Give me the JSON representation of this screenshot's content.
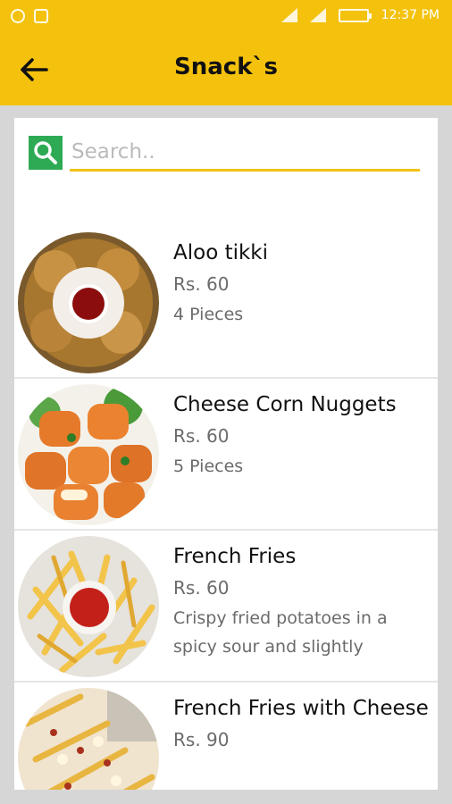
{
  "status_bar": {
    "time": "12:37 PM"
  },
  "app_bar": {
    "title": "Snack`s"
  },
  "search": {
    "placeholder": "Search.."
  },
  "items": [
    {
      "name": "Aloo tikki",
      "price": "Rs. 60",
      "desc": "4 Pieces"
    },
    {
      "name": "Cheese Corn Nuggets",
      "price": "Rs. 60",
      "desc": "5 Pieces"
    },
    {
      "name": "French Fries",
      "price": "Rs. 60",
      "desc": "Crispy fried potatoes in a spicy sour and slightly"
    },
    {
      "name": "French Fries with Cheese",
      "price": "Rs. 90",
      "desc": ""
    }
  ],
  "colors": {
    "accent": "#f4c20d",
    "search_icon_bg": "#2eaa55",
    "background": "#d6d6d6"
  }
}
